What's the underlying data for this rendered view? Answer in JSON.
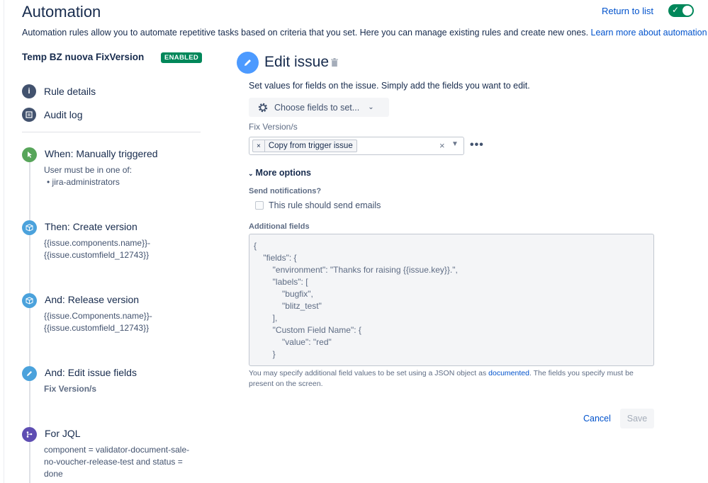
{
  "header": {
    "title": "Automation",
    "return_label": "Return to list",
    "toggle_on": true,
    "intro_text": "Automation rules allow you to automate repetitive tasks based on criteria that you set. Here you can manage existing rules and create new ones. ",
    "intro_link": "Learn more about automation"
  },
  "rule": {
    "name": "Temp BZ nuova FixVersion",
    "status_badge": "ENABLED"
  },
  "nav": [
    {
      "label": "Rule details",
      "icon": "info-icon"
    },
    {
      "label": "Audit log",
      "icon": "log-icon"
    }
  ],
  "steps": [
    {
      "title": "When: Manually triggered",
      "icon": "cursor-icon",
      "color": "#57a55a",
      "lines": [
        "User must be in one of:",
        "•  jira-administrators"
      ]
    },
    {
      "title": "Then: Create version",
      "icon": "box-icon",
      "color": "#4ba2dc",
      "lines": [
        "{{issue.components.name}}-",
        "{{issue.customfield_12743}}"
      ]
    },
    {
      "title": "And: Release version",
      "icon": "box-icon",
      "color": "#4ba2dc",
      "lines": [
        "{{issue.Components.name}}-",
        "{{issue.customfield_12743}}"
      ]
    },
    {
      "title": "And: Edit issue fields",
      "icon": "pencil-icon",
      "color": "#4ba2dc",
      "lines": [
        "Fix Version/s"
      ]
    },
    {
      "title": "For JQL",
      "icon": "branch-icon",
      "color": "#5e4db2",
      "lines": [
        "component = validator-document-sale-",
        "no-voucher-release-test and status =",
        "done"
      ]
    }
  ],
  "editor": {
    "title": "Edit issue",
    "description": "Set values for fields on the issue. Simply add the fields you want to edit.",
    "choose_label": "Choose fields to set...",
    "field_label": "Fix Version/s",
    "chip_label": "Copy from trigger issue",
    "more_options": "More options",
    "notifications_label": "Send notifications?",
    "notifications_checkbox": "This rule should send emails",
    "additional_label": "Additional fields",
    "json_lines": [
      "{",
      "    \"fields\": {",
      "        \"environment\": \"Thanks for raising {{issue.key}}.\",",
      "        \"labels\": [",
      "            \"bugfix\",",
      "            \"blitz_test\"",
      "        ],",
      "        \"Custom Field Name\": {",
      "            \"value\": \"red\"",
      "        }"
    ],
    "help_before": "You may specify additional field values to be set using a JSON object as ",
    "help_link": "documented",
    "help_after": ". The fields you specify must be present on the screen.",
    "cancel_label": "Cancel",
    "save_label": "Save"
  }
}
